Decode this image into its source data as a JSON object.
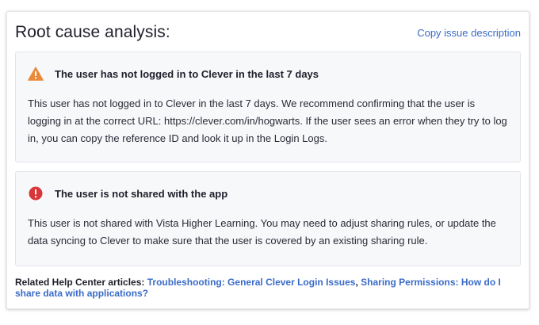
{
  "header": {
    "title": "Root cause analysis:",
    "copy_link": "Copy issue description"
  },
  "issues": [
    {
      "icon": "warning-triangle-icon",
      "icon_color": "#e88a3a",
      "title": "The user has not logged in to Clever in the last 7 days",
      "body": "This user has not logged in to Clever in the last 7 days. We recommend confirming that the user is logging in at the correct URL: https://clever.com/in/hogwarts. If the user sees an error when they try to log in, you can copy the reference ID and look it up in the Login Logs."
    },
    {
      "icon": "error-circle-icon",
      "icon_color": "#d8373a",
      "title": "The user is not shared with the app",
      "body": "This user is not shared with Vista Higher Learning. You may need to adjust sharing rules, or update the data syncing to Clever to make sure that the user is covered by an existing sharing rule."
    }
  ],
  "related": {
    "label": "Related Help Center articles:",
    "links": [
      "Troubleshooting: General Clever Login Issues",
      "Sharing Permissions: How do I share data with applications?"
    ],
    "separator": ","
  }
}
